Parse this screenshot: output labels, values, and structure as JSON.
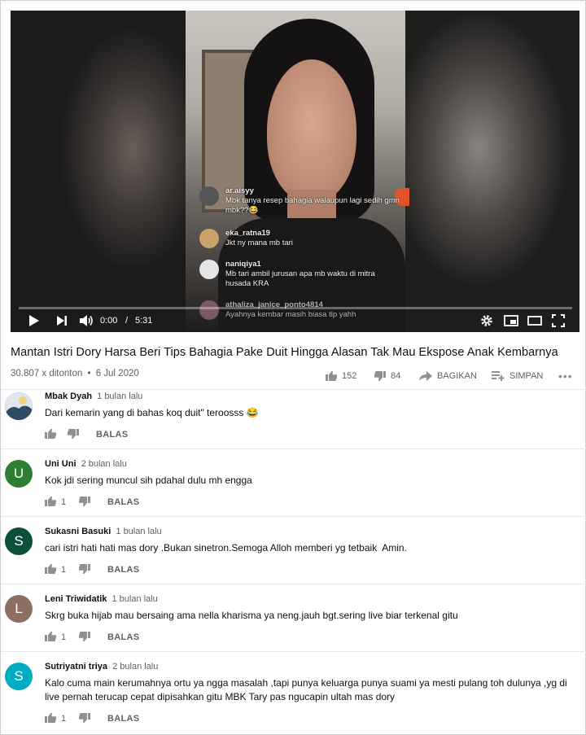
{
  "player": {
    "time_current": "0:00",
    "time_separator": "/",
    "time_total": "5:31",
    "progress_fraction": 0.0,
    "overlay_comments": [
      {
        "user": "ar.aisyy",
        "message": "Mbk tanya resep bahagia walaupun lagi sedih gmn mbk??😂"
      },
      {
        "user": "eka_ratna19",
        "message": "Jkt ny mana mb tari"
      },
      {
        "user": "naniqiya1",
        "message": "Mb tari ambil jurusan apa mb waktu di mitra husada KRA"
      },
      {
        "user": "athaliza_janice_ponto4814",
        "message": "Ayahnya kembar masih biasa tlp yahh"
      }
    ]
  },
  "video": {
    "title": "Mantan Istri Dory Harsa Beri Tips Bahagia Pake Duit Hingga Alasan Tak Mau Ekspose Anak Kembarnya",
    "views": "30.807 x ditonton",
    "dot": "•",
    "date": "6 Jul 2020",
    "likes": "152",
    "dislikes": "84",
    "share_label": "BAGIKAN",
    "save_label": "SIMPAN",
    "more_label": "•••"
  },
  "comments": [
    {
      "author": "Mbak Dyah",
      "time": "1 bulan lalu",
      "text": "Dari kemarin yang di bahas koq duit\" teroosss 😂",
      "likes": "",
      "reply": "BALAS",
      "avatar_letter": "",
      "avatar_color": "#2f4a66"
    },
    {
      "author": "Uni Uni",
      "time": "2 bulan lalu",
      "text": "Kok jdi sering muncul sih pdahal dulu mh engga",
      "likes": "1",
      "reply": "BALAS",
      "avatar_letter": "U",
      "avatar_color": "#2e7d32"
    },
    {
      "author": "Sukasni Basuki",
      "time": "1 bulan lalu",
      "text": "cari istri hati hati mas dory .Bukan sinetron.Semoga Alloh memberi yg tetbaik  Amin.",
      "likes": "1",
      "reply": "BALAS",
      "avatar_letter": "S",
      "avatar_color": "#0d4f3c"
    },
    {
      "author": "Leni Triwidatik",
      "time": "1 bulan lalu",
      "text": "Skrg buka hijab mau bersaing ama nella kharisma ya neng.jauh bgt.sering live biar terkenal gitu",
      "likes": "1",
      "reply": "BALAS",
      "avatar_letter": "L",
      "avatar_color": "#8d6e63"
    },
    {
      "author": "Sutriyatni triya",
      "time": "2 bulan lalu",
      "text": "Kalo cuma main kerumahnya ortu ya ngga masalah ,tapi punya keluarga punya suami ya mesti pulang toh dulunya ,yg di live pernah terucap cepat dipisahkan gitu MBK Tary pas ngucapin ultah mas dory",
      "likes": "1",
      "reply": "BALAS",
      "avatar_letter": "S",
      "avatar_color": "#00acc1"
    }
  ]
}
